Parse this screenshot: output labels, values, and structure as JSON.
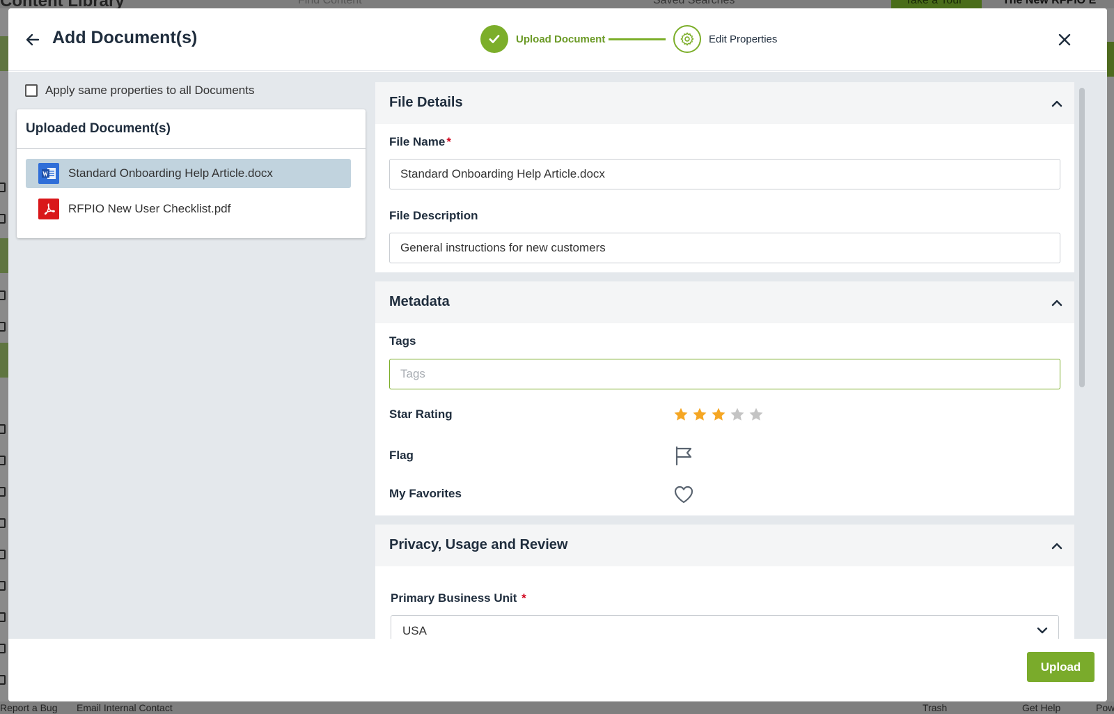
{
  "background": {
    "app_title": "Content Library",
    "search_placeholder": "Find Content",
    "saved_searches": "Saved Searches",
    "take_tour": "Take a Tour",
    "new_label": "The New RFPIO E",
    "footer": {
      "report_bug": "Report a Bug",
      "email_contact": "Email Internal Contact",
      "trash": "Trash",
      "get_help": "Get Help",
      "powered": "Pow"
    }
  },
  "modal": {
    "title": "Add Document(s)",
    "steps": [
      {
        "label": "Upload Document",
        "state": "completed"
      },
      {
        "label": "Edit Properties",
        "state": "active"
      }
    ],
    "apply_same_label": "Apply same properties to all Documents",
    "apply_same_checked": false,
    "uploaded_docs": {
      "title": "Uploaded Document(s)",
      "items": [
        {
          "name": "Standard Onboarding Help Article.docx",
          "icon": "word-doc-icon",
          "selected": true
        },
        {
          "name": "RFPIO New User Checklist.pdf",
          "icon": "pdf-icon",
          "selected": false
        }
      ]
    },
    "file_details": {
      "title": "File Details",
      "file_name_label": "File Name",
      "file_name_required": "*",
      "file_name_value": "Standard Onboarding Help Article.docx",
      "file_description_label": "File Description",
      "file_description_value": "General instructions for new customers"
    },
    "metadata": {
      "title": "Metadata",
      "tags_label": "Tags",
      "tags_placeholder": "Tags",
      "star_rating_label": "Star Rating",
      "star_rating_value": 3,
      "star_rating_max": 5,
      "flag_label": "Flag",
      "favorites_label": "My Favorites"
    },
    "privacy": {
      "title": "Privacy, Usage and Review",
      "business_unit_label": "Primary Business Unit",
      "business_unit_required": "*",
      "business_unit_value": "USA"
    },
    "upload_button": "Upload"
  },
  "colors": {
    "accent_green": "#7aab2b",
    "star_filled": "#f5a623",
    "star_empty": "#c4c4c4",
    "selected_row": "#c1d3de",
    "required": "#d0021b"
  }
}
